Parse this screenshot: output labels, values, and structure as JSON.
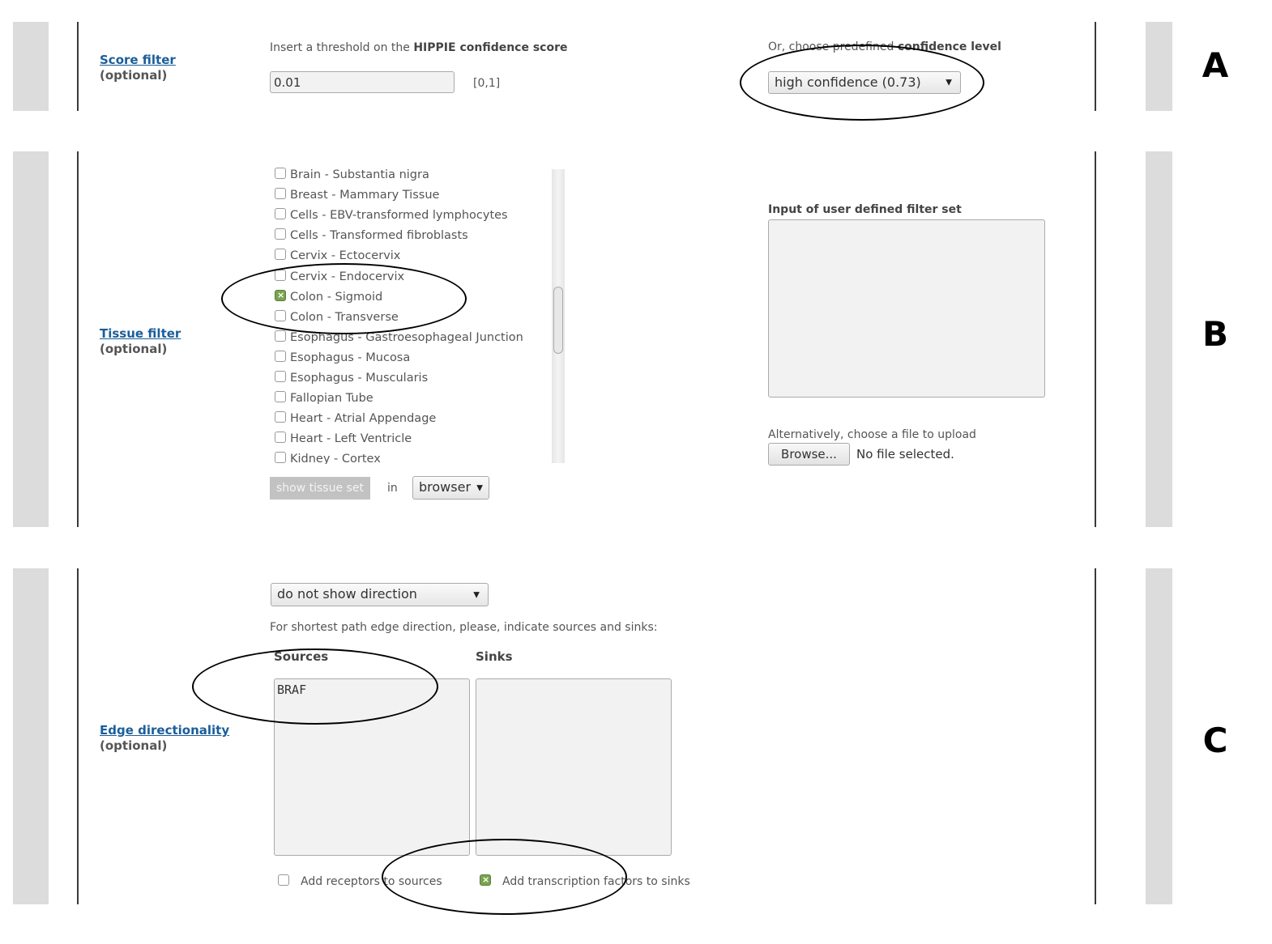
{
  "panel_labels": [
    "A",
    "B",
    "C"
  ],
  "score_filter": {
    "title": "Score filter",
    "optional": "(optional)",
    "instruction_prefix": "Insert a threshold on the ",
    "instruction_bold": "HIPPIE confidence score",
    "threshold_value": "0.01",
    "range_hint": "[0,1]",
    "predefined_prefix": "Or, choose predefined ",
    "predefined_bold": "confidence level",
    "confidence_select": "high confidence (0.73)"
  },
  "tissue_filter": {
    "title": "Tissue filter",
    "optional": "(optional)",
    "tissues": [
      {
        "label": "Brain - Substantia nigra",
        "checked": false
      },
      {
        "label": "Breast - Mammary Tissue",
        "checked": false
      },
      {
        "label": "Cells - EBV-transformed lymphocytes",
        "checked": false
      },
      {
        "label": "Cells - Transformed fibroblasts",
        "checked": false
      },
      {
        "label": "Cervix - Ectocervix",
        "checked": false
      },
      {
        "label": "Cervix - Endocervix",
        "checked": false
      },
      {
        "label": "Colon - Sigmoid",
        "checked": true
      },
      {
        "label": "Colon - Transverse",
        "checked": false
      },
      {
        "label": "Esophagus - Gastroesophageal Junction",
        "checked": false
      },
      {
        "label": "Esophagus - Mucosa",
        "checked": false
      },
      {
        "label": "Esophagus - Muscularis",
        "checked": false
      },
      {
        "label": "Fallopian Tube",
        "checked": false
      },
      {
        "label": "Heart - Atrial Appendage",
        "checked": false
      },
      {
        "label": "Heart - Left Ventricle",
        "checked": false
      },
      {
        "label": "Kidney - Cortex",
        "checked": false
      }
    ],
    "show_button": "show tissue set",
    "in_label": "in",
    "target_select": "browser",
    "user_set_label": "Input of user defined filter set",
    "user_set_value": "",
    "upload_label": "Alternatively, choose a file to upload",
    "browse_button": "Browse...",
    "file_status": "No file selected."
  },
  "edge_directionality": {
    "title": "Edge directionality",
    "optional": "(optional)",
    "direction_select": "do not show direction",
    "instruction": "For shortest path edge direction, please, indicate sources and sinks:",
    "sources_label": "Sources",
    "sources_value": "BRAF",
    "sinks_label": "Sinks",
    "sinks_value": "",
    "add_receptors_label": "Add receptors to sources",
    "add_receptors_checked": false,
    "add_tf_label": "Add transcription factors to sinks",
    "add_tf_checked": true
  }
}
